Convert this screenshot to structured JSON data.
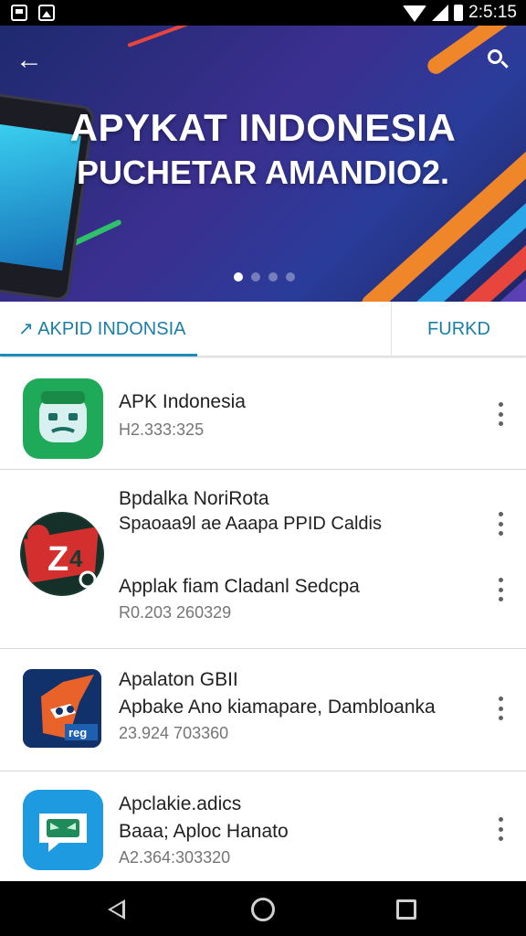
{
  "status_bar": {
    "time": "2:5:15"
  },
  "banner": {
    "title_line1": "APYKAT INDONESIA",
    "title_line2": "PUCHETAR AMANDIO2.",
    "page_count": 4,
    "active_page": 1
  },
  "tabs": [
    {
      "label": "↗ AKPID INDONSIA",
      "selected": true
    },
    {
      "label": "FURKD",
      "selected": false
    }
  ],
  "apps": [
    {
      "title": "APK Indonesia",
      "subtitle": "H2.333:325",
      "icon": "robot-face-icon",
      "color": "#1faa59"
    },
    {
      "title": "Bpdalka NoriRota",
      "line2": "Spaoaa9l ae Aaapa PPID Caldis",
      "title2": "Applak fiam Cladanl Sedcpa",
      "subtitle": "R0.203 260329",
      "icon": "z-badge-icon",
      "color": "#d32f2f"
    },
    {
      "title": "Apalaton GBII",
      "line2": "Apbake Ano kiamapare, Dambloanka",
      "subtitle": "23.924 703360",
      "icon": "fox-icon",
      "color": "#e8622a"
    },
    {
      "title": "Apclakie.adics",
      "line2": "Baaa; Aploc Hanato",
      "subtitle": "A2.364:303320",
      "icon": "chat-bubble-icon",
      "color": "#1e9be0"
    }
  ],
  "colors": {
    "accent": "#1a8cb8",
    "banner_bg": "#2b3088"
  }
}
